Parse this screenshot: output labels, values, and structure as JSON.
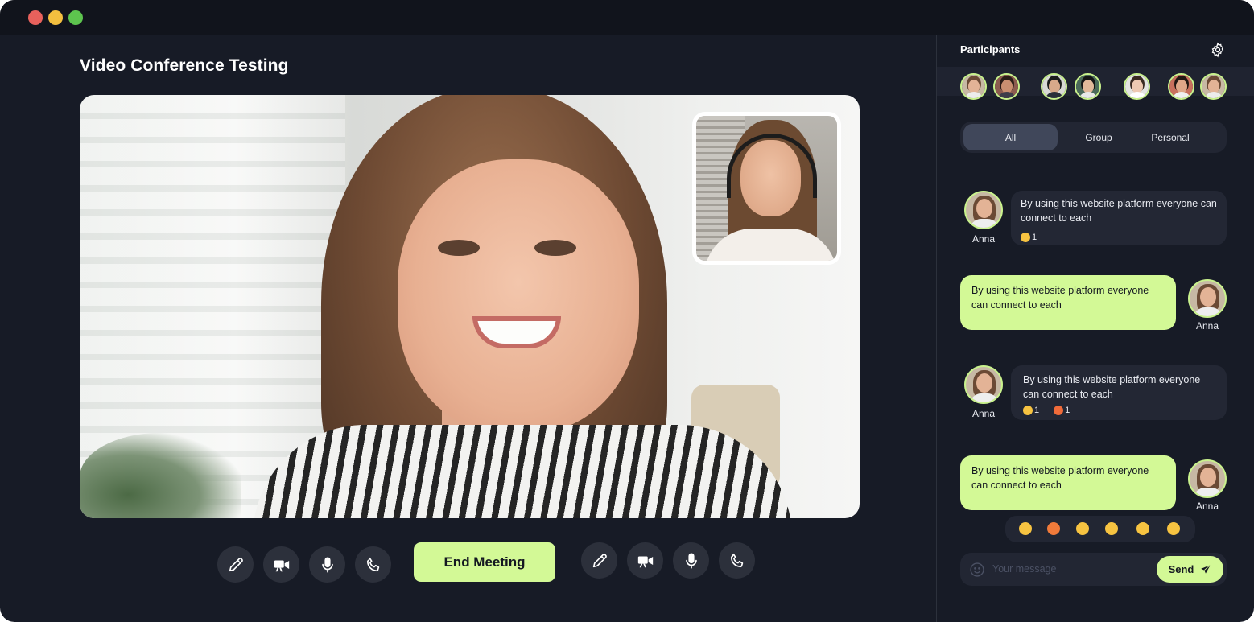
{
  "window": {
    "controls": [
      "close",
      "minimize",
      "maximize"
    ]
  },
  "meeting": {
    "title": "Video Conference Testing"
  },
  "controls": {
    "left": [
      {
        "icon": "pencil-icon",
        "label": "Annotate"
      },
      {
        "icon": "video-camera-icon",
        "label": "Camera"
      },
      {
        "icon": "microphone-icon",
        "label": "Microphone"
      },
      {
        "icon": "phone-icon",
        "label": "Call"
      }
    ],
    "end_label": "End Meeting",
    "right": [
      {
        "icon": "pencil-icon",
        "label": "Annotate"
      },
      {
        "icon": "video-camera-icon",
        "label": "Camera"
      },
      {
        "icon": "microphone-icon",
        "label": "Microphone"
      },
      {
        "icon": "phone-icon",
        "label": "Call"
      }
    ]
  },
  "participants": {
    "title": "Participants",
    "settings_icon": "gear-icon",
    "avatars": [
      {
        "palette": {
          "bg": "#c7b8a4",
          "skin": "#e3b396",
          "hair": "#6b4a35",
          "shirt": "#ececec"
        }
      },
      {
        "palette": {
          "bg": "#8c5b4f",
          "skin": "#c98f70",
          "hair": "#2b1d17",
          "shirt": "#3d3d4a"
        }
      },
      {
        "palette": {
          "bg": "#d9d9d6",
          "skin": "#d7a98a",
          "hair": "#1c1c1c",
          "shirt": "#2a2f3a"
        }
      },
      {
        "palette": {
          "bg": "#4b6a5a",
          "skin": "#e2b99a",
          "hair": "#151515",
          "shirt": "#e8e8e8"
        }
      },
      {
        "palette": {
          "bg": "#e4e4e2",
          "skin": "#eec9b2",
          "hair": "#3a2a22",
          "shirt": "#ffffff"
        }
      },
      {
        "palette": {
          "bg": "#c9705d",
          "skin": "#e0a788",
          "hair": "#231813",
          "shirt": "#f0f0f0"
        }
      },
      {
        "palette": {
          "bg": "#c7b8a4",
          "skin": "#e3b396",
          "hair": "#6b4a35",
          "shirt": "#ececec"
        }
      }
    ]
  },
  "tabs": [
    {
      "label": "All",
      "active": true
    },
    {
      "label": "Group",
      "active": false
    },
    {
      "label": "Personal",
      "active": false
    }
  ],
  "messages": [
    {
      "author": "Anna",
      "direction": "in",
      "text": "By using this website platform everyone can connect to each",
      "reactions": [
        {
          "emoji": "grin",
          "count": "1"
        }
      ]
    },
    {
      "author": "Anna",
      "direction": "out",
      "text": "By using this website platform everyone can connect to each",
      "reactions": []
    },
    {
      "author": "Anna",
      "direction": "in",
      "text": "By using this website platform everyone can connect to each",
      "reactions": [
        {
          "emoji": "grin",
          "count": "1"
        },
        {
          "emoji": "heart-eyes",
          "count": "1"
        }
      ]
    },
    {
      "author": "Anna",
      "direction": "out",
      "text": "By using this website platform everyone can connect to each",
      "reactions": []
    }
  ],
  "emoji_picker": [
    "slightly-smiling",
    "heart-eyes",
    "grinning",
    "smiling",
    "slightly-frowning",
    "grin"
  ],
  "composer": {
    "placeholder": "Your message",
    "value": "",
    "send_label": "Send"
  },
  "colors": {
    "accent": "#d3f996",
    "background": "#171b26",
    "panel": "#222633"
  }
}
